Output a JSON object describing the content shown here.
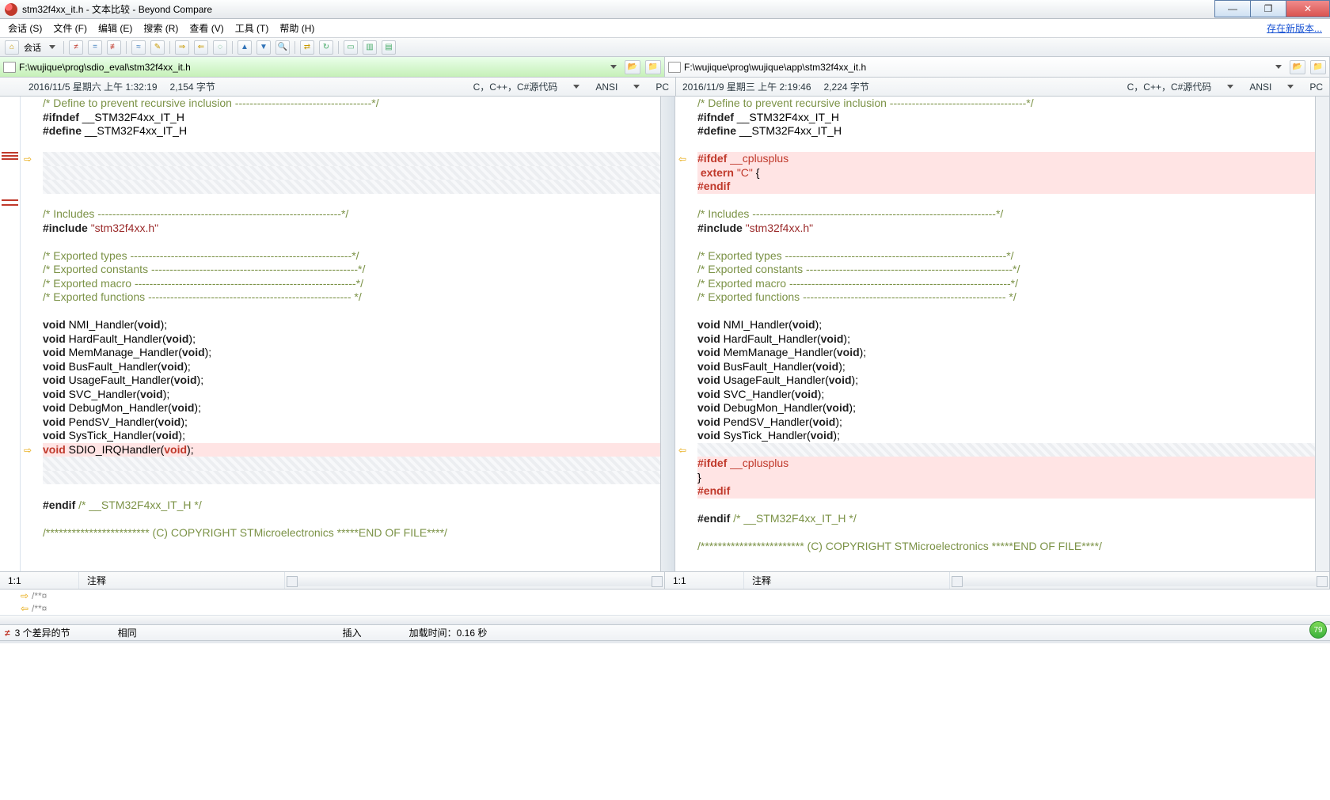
{
  "title": "stm32f4xx_it.h - 文本比较 - Beyond Compare",
  "menu": [
    "会话 (S)",
    "文件 (F)",
    "编辑 (E)",
    "搜索 (R)",
    "查看 (V)",
    "工具 (T)",
    "帮助 (H)"
  ],
  "new_version": "存在新版本...",
  "left": {
    "path": "F:\\wujique\\prog\\sdio_eval\\stm32f4xx_it.h",
    "date": "2016/11/5 星期六 上午 1:32:19",
    "bytes": "2,154 字节",
    "lang": "C，C++，C#源代码",
    "encoding": "ANSI",
    "lineend": "PC",
    "cursor": "1:1",
    "status_label": "注释"
  },
  "right": {
    "path": "F:\\wujique\\prog\\wujique\\app\\stm32f4xx_it.h",
    "date": "2016/11/9 星期三 上午 2:19:46",
    "bytes": "2,224 字节",
    "lang": "C，C++，C#源代码",
    "encoding": "ANSI",
    "lineend": "PC",
    "cursor": "1:1",
    "status_label": "注释"
  },
  "diff_bottom_lines": [
    "/**¤",
    "/**¤"
  ],
  "status": {
    "diffs": "3 个差异的节",
    "same": "相同",
    "insert": "插入",
    "load_time": "加载时间：0.16 秒"
  },
  "green_bubble": "79",
  "code_left": [
    {
      "cls": "",
      "html": "<span class='c-comment'>/* Define to prevent recursive inclusion -------------------------------------*/</span>"
    },
    {
      "cls": "",
      "html": "<span class='c-pre'>#ifndef</span> __STM32F4xx_IT_H"
    },
    {
      "cls": "",
      "html": "<span class='c-pre'>#define</span> __STM32F4xx_IT_H"
    },
    {
      "cls": "",
      "html": ""
    },
    {
      "cls": "hatched",
      "html": ""
    },
    {
      "cls": "hatched",
      "html": ""
    },
    {
      "cls": "hatched",
      "html": ""
    },
    {
      "cls": "",
      "html": ""
    },
    {
      "cls": "",
      "html": "<span class='c-comment'>/* Includes ------------------------------------------------------------------*/</span>"
    },
    {
      "cls": "",
      "html": "<span class='c-pre'>#include</span> <span class='c-str'>\"stm32f4xx.h\"</span>"
    },
    {
      "cls": "",
      "html": ""
    },
    {
      "cls": "",
      "html": "<span class='c-comment'>/* Exported types ------------------------------------------------------------*/</span>"
    },
    {
      "cls": "",
      "html": "<span class='c-comment'>/* Exported constants --------------------------------------------------------*/</span>"
    },
    {
      "cls": "",
      "html": "<span class='c-comment'>/* Exported macro ------------------------------------------------------------*/</span>"
    },
    {
      "cls": "",
      "html": "<span class='c-comment'>/* Exported functions ------------------------------------------------------- */</span>"
    },
    {
      "cls": "",
      "html": ""
    },
    {
      "cls": "",
      "html": "<span class='c-key'>void</span> NMI_Handler(<span class='c-key'>void</span>);"
    },
    {
      "cls": "",
      "html": "<span class='c-key'>void</span> HardFault_Handler(<span class='c-key'>void</span>);"
    },
    {
      "cls": "",
      "html": "<span class='c-key'>void</span> MemManage_Handler(<span class='c-key'>void</span>);"
    },
    {
      "cls": "",
      "html": "<span class='c-key'>void</span> BusFault_Handler(<span class='c-key'>void</span>);"
    },
    {
      "cls": "",
      "html": "<span class='c-key'>void</span> UsageFault_Handler(<span class='c-key'>void</span>);"
    },
    {
      "cls": "",
      "html": "<span class='c-key'>void</span> SVC_Handler(<span class='c-key'>void</span>);"
    },
    {
      "cls": "",
      "html": "<span class='c-key'>void</span> DebugMon_Handler(<span class='c-key'>void</span>);"
    },
    {
      "cls": "",
      "html": "<span class='c-key'>void</span> PendSV_Handler(<span class='c-key'>void</span>);"
    },
    {
      "cls": "",
      "html": "<span class='c-key'>void</span> SysTick_Handler(<span class='c-key'>void</span>);"
    },
    {
      "cls": "diff-red",
      "html": "<span class='c-key'>void</span> SDIO_IRQHandler(<span class='c-key'>void</span>);"
    },
    {
      "cls": "hatched",
      "html": ""
    },
    {
      "cls": "hatched",
      "html": ""
    },
    {
      "cls": "",
      "html": ""
    },
    {
      "cls": "",
      "html": "<span class='c-pre'>#endif</span> <span class='c-comment'>/* __STM32F4xx_IT_H */</span>"
    },
    {
      "cls": "",
      "html": ""
    },
    {
      "cls": "",
      "html": "<span class='c-comment'>/************************ (C) COPYRIGHT STMicroelectronics *****END OF FILE****/</span>"
    },
    {
      "cls": "",
      "html": ""
    }
  ],
  "code_right": [
    {
      "cls": "",
      "html": "<span class='c-comment'>/* Define to prevent recursive inclusion -------------------------------------*/</span>"
    },
    {
      "cls": "",
      "html": "<span class='c-pre'>#ifndef</span> __STM32F4xx_IT_H"
    },
    {
      "cls": "",
      "html": "<span class='c-pre'>#define</span> __STM32F4xx_IT_H"
    },
    {
      "cls": "",
      "html": ""
    },
    {
      "cls": "diff-red",
      "html": "<span class='c-pre'>#ifdef</span> <span>__cplusplus</span>"
    },
    {
      "cls": "diff-red",
      "html": " <span class='c-key'>extern</span> <span class='c-str'>\"C\"</span> {"
    },
    {
      "cls": "diff-red",
      "html": "<span class='c-pre'>#endif</span>"
    },
    {
      "cls": "",
      "html": ""
    },
    {
      "cls": "",
      "html": "<span class='c-comment'>/* Includes ------------------------------------------------------------------*/</span>"
    },
    {
      "cls": "",
      "html": "<span class='c-pre'>#include</span> <span class='c-str'>\"stm32f4xx.h\"</span>"
    },
    {
      "cls": "",
      "html": ""
    },
    {
      "cls": "",
      "html": "<span class='c-comment'>/* Exported types ------------------------------------------------------------*/</span>"
    },
    {
      "cls": "",
      "html": "<span class='c-comment'>/* Exported constants --------------------------------------------------------*/</span>"
    },
    {
      "cls": "",
      "html": "<span class='c-comment'>/* Exported macro ------------------------------------------------------------*/</span>"
    },
    {
      "cls": "",
      "html": "<span class='c-comment'>/* Exported functions ------------------------------------------------------- */</span>"
    },
    {
      "cls": "",
      "html": ""
    },
    {
      "cls": "",
      "html": "<span class='c-key'>void</span> NMI_Handler(<span class='c-key'>void</span>);"
    },
    {
      "cls": "",
      "html": "<span class='c-key'>void</span> HardFault_Handler(<span class='c-key'>void</span>);"
    },
    {
      "cls": "",
      "html": "<span class='c-key'>void</span> MemManage_Handler(<span class='c-key'>void</span>);"
    },
    {
      "cls": "",
      "html": "<span class='c-key'>void</span> BusFault_Handler(<span class='c-key'>void</span>);"
    },
    {
      "cls": "",
      "html": "<span class='c-key'>void</span> UsageFault_Handler(<span class='c-key'>void</span>);"
    },
    {
      "cls": "",
      "html": "<span class='c-key'>void</span> SVC_Handler(<span class='c-key'>void</span>);"
    },
    {
      "cls": "",
      "html": "<span class='c-key'>void</span> DebugMon_Handler(<span class='c-key'>void</span>);"
    },
    {
      "cls": "",
      "html": "<span class='c-key'>void</span> PendSV_Handler(<span class='c-key'>void</span>);"
    },
    {
      "cls": "",
      "html": "<span class='c-key'>void</span> SysTick_Handler(<span class='c-key'>void</span>);"
    },
    {
      "cls": "hatched",
      "html": ""
    },
    {
      "cls": "diff-red",
      "html": "<span class='c-pre'>#ifdef</span> <span>__cplusplus</span>"
    },
    {
      "cls": "diff-red",
      "html": "}"
    },
    {
      "cls": "diff-red",
      "html": "<span class='c-pre'>#endif</span>"
    },
    {
      "cls": "",
      "html": ""
    },
    {
      "cls": "",
      "html": "<span class='c-pre'>#endif</span> <span class='c-comment'>/* __STM32F4xx_IT_H */</span>"
    },
    {
      "cls": "",
      "html": ""
    },
    {
      "cls": "",
      "html": "<span class='c-comment'>/************************ (C) COPYRIGHT STMicroelectronics *****END OF FILE****/</span>"
    },
    {
      "cls": "",
      "html": ""
    }
  ],
  "gutter_arrows_left": [
    {
      "row": 4,
      "dir": "r"
    },
    {
      "row": 25,
      "dir": "r"
    }
  ],
  "gutter_arrows_right": [
    {
      "row": 4,
      "dir": "l"
    },
    {
      "row": 25,
      "dir": "l"
    }
  ]
}
